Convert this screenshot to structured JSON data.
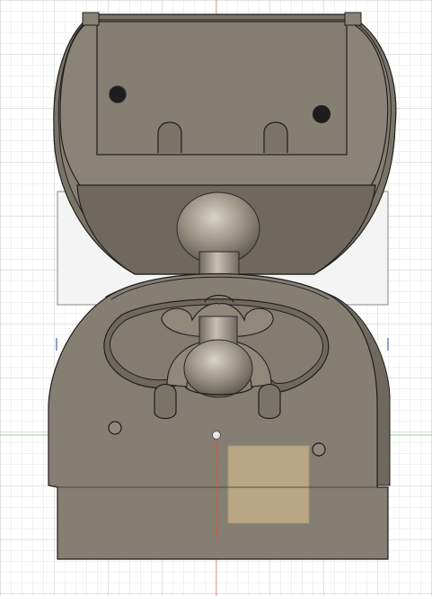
{
  "viewport": {
    "background": "#ffffff",
    "grid_minor_color": "#e3e3e3",
    "grid_major_color": "#c6c6c6",
    "axis_red_color": "#d84a3a",
    "axis_green_color": "#4fb24f"
  },
  "model": {
    "body_color": "#827b70",
    "body_color_dark": "#6c665d",
    "body_color_light": "#a9a294",
    "outline_color": "#1f1f1f",
    "ghost_color": "#f2f2f2",
    "selected_face_color": "#c9b48c"
  },
  "icons": [
    "origin-point-icon"
  ]
}
